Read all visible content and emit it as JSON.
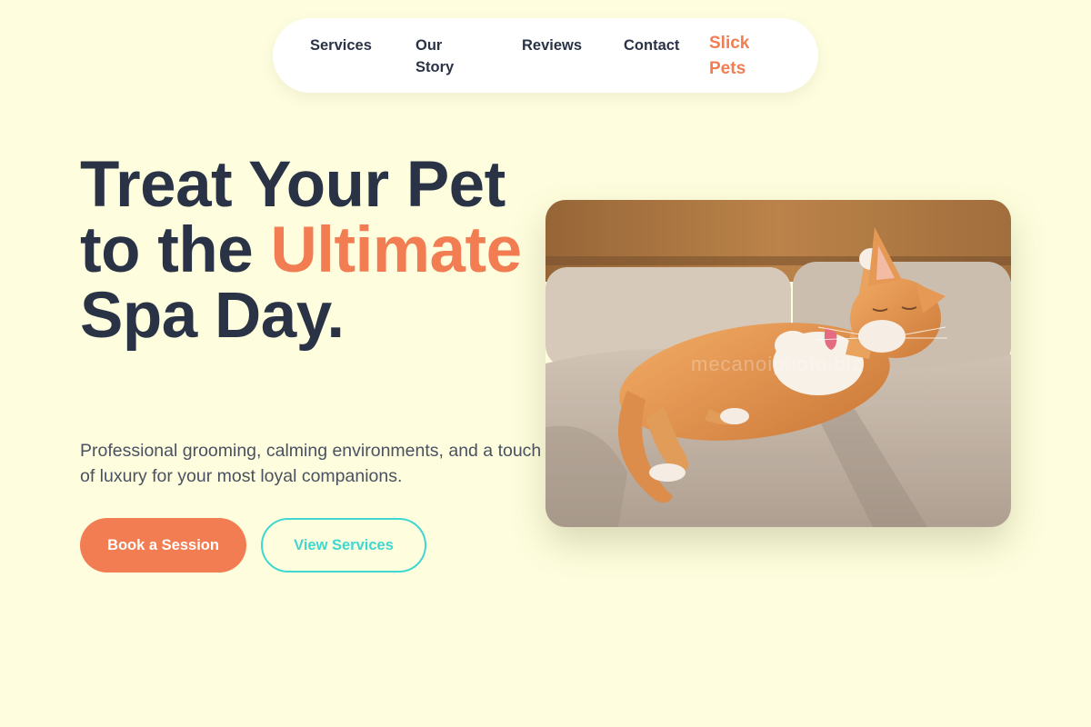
{
  "nav": {
    "links": [
      {
        "label": "Services"
      },
      {
        "label": "Our Story"
      },
      {
        "label": "Reviews"
      },
      {
        "label": "Contact"
      }
    ],
    "brand": "Slick Pets"
  },
  "hero": {
    "title_part1": "Treat Your Pet to the ",
    "title_accent": "Ultimate",
    "title_part2": " Spa Day.",
    "subtitle": "Professional grooming, calming environments, and a touch of luxury for your most loyal companions.",
    "primary_button": "Book a Session",
    "secondary_button": "View Services",
    "image": {
      "subject": "orange-cat-on-couch",
      "watermark": "mecanoiphoto.biz"
    }
  },
  "colors": {
    "background": "#FEFEDE",
    "accent": "#F27D52",
    "secondary": "#3FD7CF",
    "text": "#2A3346"
  }
}
